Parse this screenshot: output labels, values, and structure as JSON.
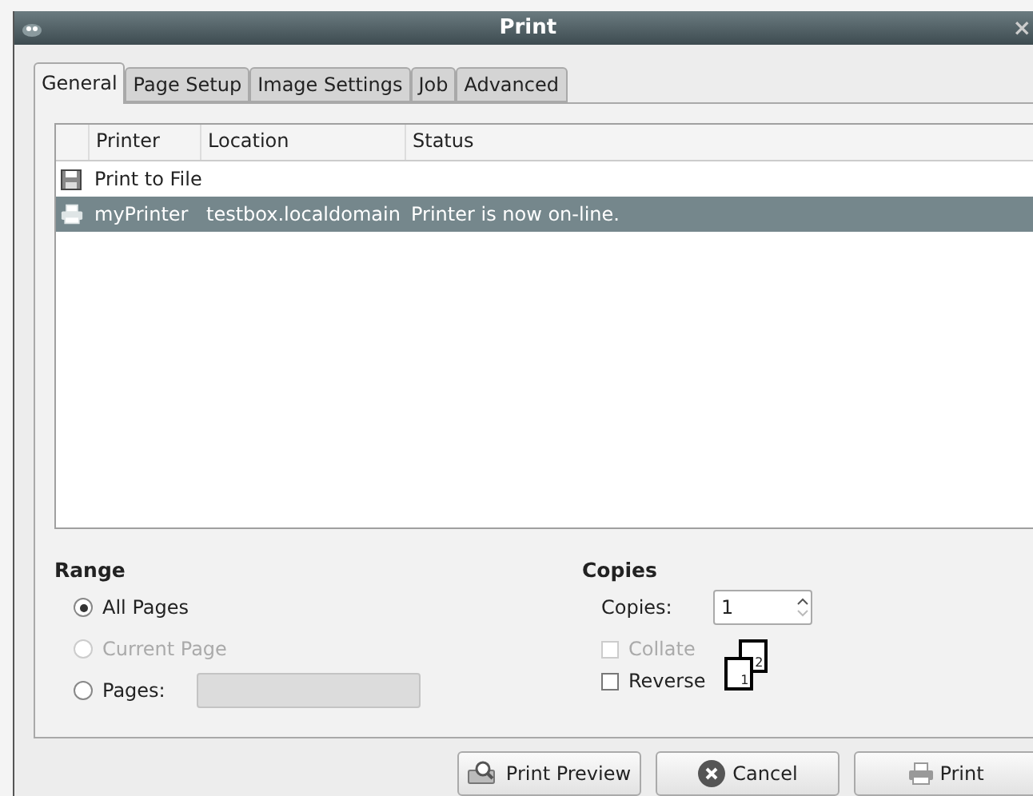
{
  "window": {
    "title": "Print",
    "close": "×"
  },
  "tabs": [
    {
      "label": "General",
      "selected": true
    },
    {
      "label": "Page Setup",
      "selected": false
    },
    {
      "label": "Image Settings",
      "selected": false
    },
    {
      "label": "Job",
      "selected": false
    },
    {
      "label": "Advanced",
      "selected": false
    }
  ],
  "printers": {
    "columns": [
      "Printer",
      "Location",
      "Status"
    ],
    "rows": [
      {
        "kind": "file",
        "name": "Print to File",
        "location": "",
        "status": "",
        "selected": false
      },
      {
        "kind": "printer",
        "name": "myPrinter",
        "location": "testbox.localdomain",
        "status": "Printer is now on-line.",
        "selected": true
      }
    ]
  },
  "range": {
    "title": "Range",
    "options": [
      {
        "label": "All Pages",
        "selected": true,
        "disabled": false,
        "kind": "plain"
      },
      {
        "label": "Current Page",
        "selected": false,
        "disabled": true,
        "kind": "plain"
      },
      {
        "label": "Pages:",
        "selected": false,
        "disabled": false,
        "kind": "entry"
      }
    ]
  },
  "copies": {
    "title": "Copies",
    "label": "Copies:",
    "value": "1",
    "options": [
      {
        "label": "Collate",
        "checked": false,
        "disabled": true
      },
      {
        "label": "Reverse",
        "checked": false,
        "disabled": false
      }
    ],
    "page_numbers": [
      "1",
      "2"
    ]
  },
  "buttons": [
    {
      "kind": "preview",
      "label": "Print Preview"
    },
    {
      "kind": "cancel",
      "label": "Cancel"
    },
    {
      "kind": "print",
      "label": "Print"
    }
  ]
}
